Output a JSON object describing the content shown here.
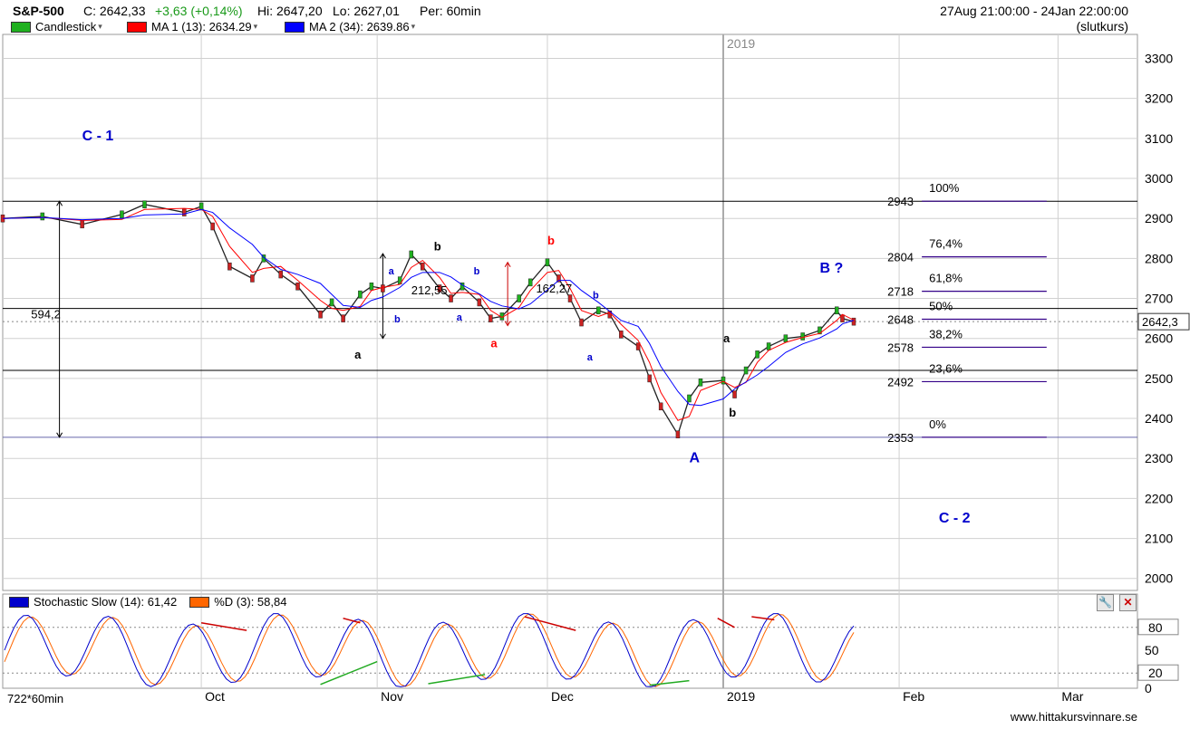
{
  "header": {
    "symbol": "S&P-500",
    "close": "C: 2642,33",
    "change": "+3,63 (+0,14%)",
    "high": "Hi: 2647,20",
    "low": "Lo: 2627,01",
    "period": "Per: 60min",
    "date_range": "27Aug 21:00:00 - 24Jan 22:00:00",
    "price_type": "(slutkurs)"
  },
  "indicators": [
    {
      "label": "Candlestick",
      "color": "#1fb01f"
    },
    {
      "label": "MA 1 (13): 2634.29",
      "color": "#ff0000"
    },
    {
      "label": "MA 2 (34): 2639.86",
      "color": "#0000ff"
    }
  ],
  "stochastic": {
    "k_label": "Stochastic Slow (14): 61,42",
    "d_label": "%D (3): 58,84",
    "k_color": "#0000cc",
    "d_color": "#ff6600",
    "y_ticks": [
      "80",
      "50",
      "20",
      "0"
    ],
    "overbought": 80,
    "oversold": 20
  },
  "tools": {
    "wrench": "wrench-icon",
    "close": "close-icon"
  },
  "x_axis": {
    "ticks": [
      "Oct",
      "Nov",
      "Dec",
      "2019",
      "Feb",
      "Mar"
    ],
    "year_marker": "2019",
    "bar_count": "722*60min"
  },
  "footer": "www.hittakursvinnare.se",
  "chart_data": {
    "type": "line",
    "title": "S&P-500",
    "ylim": [
      1970,
      3360
    ],
    "y_ticks": [
      2000,
      2100,
      2200,
      2300,
      2400,
      2500,
      2600,
      2700,
      2800,
      2900,
      3000,
      3100,
      3200,
      3300
    ],
    "last_price_label": "2642,3",
    "grid": true,
    "series": [
      {
        "name": "S&P-500",
        "color": "#1a1a1a",
        "x": [
          "2018-08-27",
          "2018-09-03",
          "2018-09-10",
          "2018-09-17",
          "2018-09-21",
          "2018-09-28",
          "2018-10-01",
          "2018-10-03",
          "2018-10-06",
          "2018-10-10",
          "2018-10-12",
          "2018-10-15",
          "2018-10-18",
          "2018-10-22",
          "2018-10-24",
          "2018-10-26",
          "2018-10-29",
          "2018-10-31",
          "2018-11-02",
          "2018-11-05",
          "2018-11-07",
          "2018-11-09",
          "2018-11-12",
          "2018-11-14",
          "2018-11-16",
          "2018-11-19",
          "2018-11-21",
          "2018-11-23",
          "2018-11-26",
          "2018-11-28",
          "2018-12-01",
          "2018-12-03",
          "2018-12-05",
          "2018-12-07",
          "2018-12-10",
          "2018-12-12",
          "2018-12-14",
          "2018-12-17",
          "2018-12-19",
          "2018-12-21",
          "2018-12-24",
          "2018-12-26",
          "2018-12-28",
          "2019-01-01",
          "2019-01-03",
          "2019-01-05",
          "2019-01-07",
          "2019-01-09",
          "2019-01-12",
          "2019-01-15",
          "2019-01-18",
          "2019-01-21",
          "2019-01-22",
          "2019-01-24"
        ],
        "values": [
          2900,
          2905,
          2885,
          2910,
          2935,
          2915,
          2930,
          2880,
          2780,
          2750,
          2800,
          2760,
          2730,
          2660,
          2690,
          2650,
          2710,
          2730,
          2725,
          2745,
          2810,
          2780,
          2725,
          2700,
          2730,
          2690,
          2650,
          2655,
          2700,
          2740,
          2790,
          2750,
          2700,
          2640,
          2670,
          2660,
          2610,
          2580,
          2500,
          2430,
          2360,
          2450,
          2490,
          2495,
          2460,
          2520,
          2560,
          2580,
          2600,
          2605,
          2620,
          2670,
          2650,
          2642
        ]
      },
      {
        "name": "MA 1 (13)",
        "color": "#ff0000",
        "last": 2634.29
      },
      {
        "name": "MA 2 (34)",
        "color": "#0000ff",
        "last": 2639.86
      }
    ],
    "fibonacci": {
      "levels": [
        {
          "pct": "100%",
          "value": 2943
        },
        {
          "pct": "76,4%",
          "value": 2804
        },
        {
          "pct": "61,8%",
          "value": 2718
        },
        {
          "pct": "50%",
          "value": 2648
        },
        {
          "pct": "38,2%",
          "value": 2578
        },
        {
          "pct": "23,6%",
          "value": 2492
        },
        {
          "pct": "0%",
          "value": 2353
        }
      ]
    },
    "annotations": [
      {
        "text": "C - 1",
        "x": "2018-09-10",
        "y": 3095,
        "color": "#0000cc",
        "size": 16
      },
      {
        "text": "B ?",
        "x": "2019-01-18",
        "y": 2765,
        "color": "#0000cc",
        "size": 16
      },
      {
        "text": "A",
        "x": "2018-12-26",
        "y": 2290,
        "color": "#0000cc",
        "size": 16
      },
      {
        "text": "C - 2",
        "x": "2019-02-08",
        "y": 2140,
        "color": "#0000cc",
        "size": 16
      },
      {
        "text": "594,2",
        "x": "2018-09-01",
        "y": 2650,
        "color": "#000000",
        "size": 13,
        "normal": true
      },
      {
        "text": "212,55",
        "x": "2018-11-07",
        "y": 2710,
        "color": "#000000",
        "size": 13,
        "normal": true
      },
      {
        "text": "162,27",
        "x": "2018-11-29",
        "y": 2715,
        "color": "#000000",
        "size": 13,
        "normal": true
      },
      {
        "text": "a",
        "x": "2018-10-28",
        "y": 2550,
        "color": "#000000",
        "size": 13
      },
      {
        "text": "b",
        "x": "2018-11-11",
        "y": 2820,
        "color": "#000000",
        "size": 13
      },
      {
        "text": "a",
        "x": "2018-11-21",
        "y": 2578,
        "color": "#ff0000",
        "size": 13
      },
      {
        "text": "b",
        "x": "2018-12-01",
        "y": 2835,
        "color": "#ff0000",
        "size": 13
      },
      {
        "text": "a",
        "x": "2019-01-01",
        "y": 2590,
        "color": "#000000",
        "size": 13
      },
      {
        "text": "b",
        "x": "2019-01-02",
        "y": 2405,
        "color": "#000000",
        "size": 13
      },
      {
        "text": "a",
        "x": "2018-11-03",
        "y": 2760,
        "color": "#0000cc",
        "size": 11
      },
      {
        "text": "b",
        "x": "2018-11-04",
        "y": 2640,
        "color": "#0000cc",
        "size": 11
      },
      {
        "text": "b",
        "x": "2018-11-18",
        "y": 2760,
        "color": "#0000cc",
        "size": 11
      },
      {
        "text": "a",
        "x": "2018-11-15",
        "y": 2645,
        "color": "#0000cc",
        "size": 11
      },
      {
        "text": "b",
        "x": "2018-12-09",
        "y": 2700,
        "color": "#0000cc",
        "size": 11
      },
      {
        "text": "a",
        "x": "2018-12-08",
        "y": 2545,
        "color": "#0000cc",
        "size": 11
      }
    ]
  }
}
